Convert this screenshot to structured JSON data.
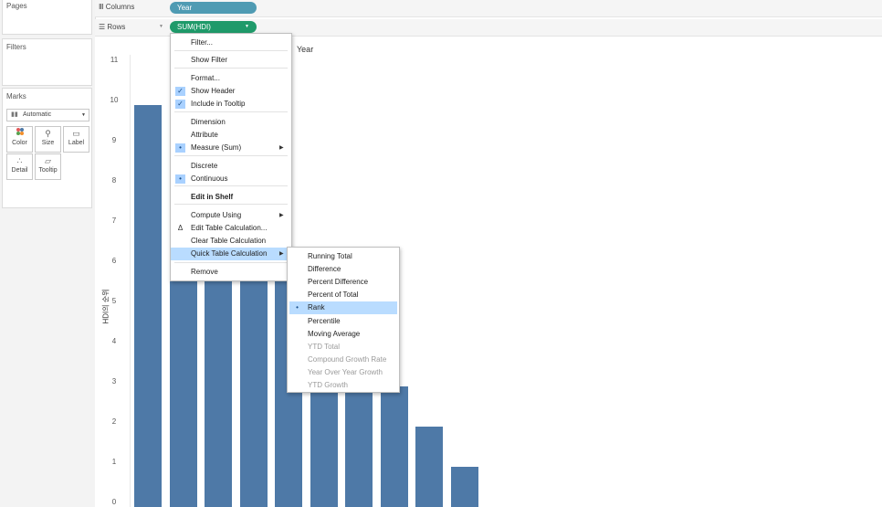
{
  "panels": {
    "pages": "Pages",
    "filters": "Filters",
    "marks": {
      "title": "Marks",
      "type": "Automatic",
      "buttons": [
        "Color",
        "Size",
        "Label",
        "Detail",
        "Tooltip"
      ]
    }
  },
  "shelves": {
    "columns": {
      "label": "Columns",
      "pill": "Year",
      "pill_color": "#4f9bb3"
    },
    "rows": {
      "label": "Rows",
      "pill": "SUM(HDI)",
      "pill_color": "#1f9a6a"
    }
  },
  "chart": {
    "x_header": "Year",
    "y_axis_label": "HDI의 순위",
    "y_ticks": [
      "11",
      "10",
      "9",
      "8",
      "7",
      "6",
      "5",
      "4",
      "3",
      "2",
      "1",
      "0"
    ],
    "bar_color": "#4e79a7"
  },
  "chart_data": {
    "type": "bar",
    "values": [
      10,
      9,
      8,
      7,
      6,
      5,
      4,
      3,
      2,
      1
    ],
    "ylim": [
      0,
      11
    ],
    "ylabel": "HDI의 순위",
    "xlabel": "Year"
  },
  "context_menu": {
    "items": [
      {
        "label": "Filter...",
        "checked": false
      },
      {
        "label": "Show Filter",
        "checked": false
      },
      {
        "label": "Format...",
        "checked": false
      },
      {
        "label": "Show Header",
        "checked": true
      },
      {
        "label": "Include in Tooltip",
        "checked": true
      },
      {
        "label": "Dimension",
        "checked": false
      },
      {
        "label": "Attribute",
        "checked": false
      },
      {
        "label": "Measure (Sum)",
        "dot": true,
        "submenu": true
      },
      {
        "label": "Discrete",
        "checked": false
      },
      {
        "label": "Continuous",
        "dot": true
      },
      {
        "label": "Edit in Shelf",
        "bold": true
      },
      {
        "label": "Compute Using",
        "submenu": true
      },
      {
        "label": "Edit Table Calculation...",
        "delta": true
      },
      {
        "label": "Clear Table Calculation"
      },
      {
        "label": "Quick Table Calculation",
        "submenu": true,
        "highlighted": true
      },
      {
        "label": "Remove"
      }
    ]
  },
  "submenu": {
    "items": [
      {
        "label": "Running Total"
      },
      {
        "label": "Difference"
      },
      {
        "label": "Percent Difference"
      },
      {
        "label": "Percent of Total"
      },
      {
        "label": "Rank",
        "selected": true
      },
      {
        "label": "Percentile"
      },
      {
        "label": "Moving Average"
      },
      {
        "label": "YTD Total",
        "disabled": true
      },
      {
        "label": "Compound Growth Rate",
        "disabled": true
      },
      {
        "label": "Year Over Year Growth",
        "disabled": true
      },
      {
        "label": "YTD Growth",
        "disabled": true
      }
    ]
  },
  "glyphs": {
    "check": "✓",
    "dot": "•",
    "delta": "Δ",
    "arrow": "▶",
    "dropdown": "▼",
    "columns_icon": "Ⅲ",
    "rows_icon": "☰"
  }
}
